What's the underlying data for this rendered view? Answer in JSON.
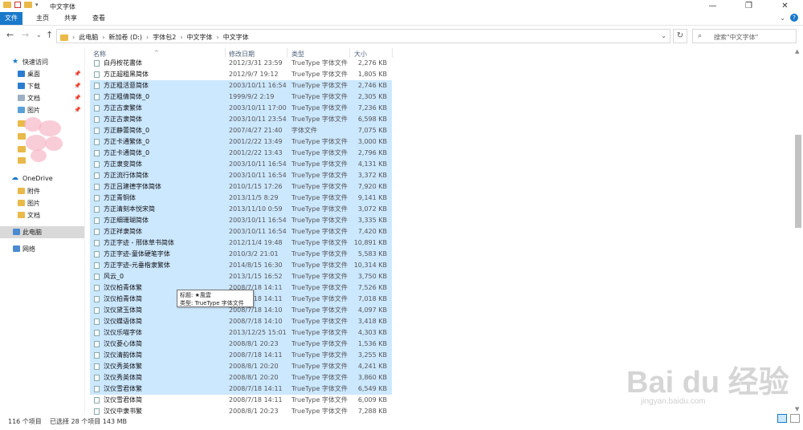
{
  "window": {
    "title": "中文字体",
    "buttons": [
      "—",
      "❐",
      "✕"
    ]
  },
  "ribbon": {
    "tabs": [
      "文件",
      "主页",
      "共享",
      "查看"
    ]
  },
  "address": {
    "crumbs": [
      "此电脑",
      "新加卷 (D:)",
      "字体包2",
      "中文字体",
      "中文字体"
    ],
    "separator": "›"
  },
  "search": {
    "placeholder": "搜索\"中文字体\""
  },
  "nav": {
    "quick_access": "快速访问",
    "items": [
      "桌面",
      "下载",
      "文档",
      "图片"
    ],
    "onedrive": "OneDrive",
    "onedrive_items": [
      "附件",
      "图片",
      "文档"
    ],
    "this_pc": "此电脑",
    "network": "网络"
  },
  "columns": {
    "name": "名称",
    "date": "修改日期",
    "type": "类型",
    "size": "大小"
  },
  "files": [
    {
      "name": "白丹桉花書体",
      "date": "2012/3/31 23:59",
      "type": "TrueType 字体文件",
      "size": "2,276 KB",
      "selected": false
    },
    {
      "name": "方正超粗黑简体",
      "date": "2012/9/7 19:12",
      "type": "TrueType 字体文件",
      "size": "1,805 KB",
      "selected": false
    },
    {
      "name": "方正粗活意简体",
      "date": "2003/10/11 16:54",
      "type": "TrueType 字体文件",
      "size": "2,746 KB",
      "selected": true
    },
    {
      "name": "方正粗倩简体_0",
      "date": "1999/9/2 2:19",
      "type": "TrueType 字体文件",
      "size": "2,305 KB",
      "selected": true
    },
    {
      "name": "方正古隶繁体",
      "date": "2003/10/11 17:00",
      "type": "TrueType 字体文件",
      "size": "7,236 KB",
      "selected": true
    },
    {
      "name": "方正古隶简体",
      "date": "2003/10/11 23:54",
      "type": "TrueType 字体文件",
      "size": "6,598 KB",
      "selected": true
    },
    {
      "name": "方正静蕾简体_0",
      "date": "2007/4/27 21:40",
      "type": "字体文件",
      "size": "7,075 KB",
      "selected": true
    },
    {
      "name": "方正卡通繁体_0",
      "date": "2001/2/22 13:49",
      "type": "TrueType 字体文件",
      "size": "3,000 KB",
      "selected": true
    },
    {
      "name": "方正卡通简体_0",
      "date": "2001/2/22 13:43",
      "type": "TrueType 字体文件",
      "size": "2,796 KB",
      "selected": true
    },
    {
      "name": "方正隶变简体",
      "date": "2003/10/11 16:54",
      "type": "TrueType 字体文件",
      "size": "4,131 KB",
      "selected": true
    },
    {
      "name": "方正流行体简体",
      "date": "2003/10/11 16:54",
      "type": "TrueType 字体文件",
      "size": "3,372 KB",
      "selected": true
    },
    {
      "name": "方正吕建德字体简体",
      "date": "2010/1/15 17:26",
      "type": "TrueType 字体文件",
      "size": "7,920 KB",
      "selected": true
    },
    {
      "name": "方正青铜体",
      "date": "2013/11/5 8:29",
      "type": "TrueType 字体文件",
      "size": "9,141 KB",
      "selected": true
    },
    {
      "name": "方正清刻本悦宋简",
      "date": "2013/11/10 0:59",
      "type": "TrueType 字体文件",
      "size": "3,072 KB",
      "selected": true
    },
    {
      "name": "方正细珊瑚简体",
      "date": "2003/10/11 16:54",
      "type": "TrueType 字体文件",
      "size": "3,335 KB",
      "selected": true
    },
    {
      "name": "方正祥隶简体",
      "date": "2003/10/11 16:54",
      "type": "TrueType 字体文件",
      "size": "7,420 KB",
      "selected": true
    },
    {
      "name": "方正字迹 - 邢体草书简体",
      "date": "2012/11/4 19:48",
      "type": "TrueType 字体文件",
      "size": "10,891 KB",
      "selected": true
    },
    {
      "name": "方正字迹-童体硬笔字体",
      "date": "2010/3/2 21:01",
      "type": "TrueType 字体文件",
      "size": "5,583 KB",
      "selected": true
    },
    {
      "name": "方正字迹-元垂楷隶繁体",
      "date": "2014/8/15 16:30",
      "type": "TrueType 字体文件",
      "size": "10,314 KB",
      "selected": true
    },
    {
      "name": "风云_0",
      "date": "2013/1/15 16:52",
      "type": "TrueType 字体文件",
      "size": "3,750 KB",
      "selected": true
    },
    {
      "name": "汉仪柏青体繁",
      "date": "2008/7/18 14:11",
      "type": "TrueType 字体文件",
      "size": "7,526 KB",
      "selected": true
    },
    {
      "name": "汉仪柏青体简",
      "date": "2008/7/18 14:11",
      "type": "TrueType 字体文件",
      "size": "7,018 KB",
      "selected": true
    },
    {
      "name": "汉仪黛玉体简",
      "date": "2008/7/18 14:10",
      "type": "TrueType 字体文件",
      "size": "4,097 KB",
      "selected": true
    },
    {
      "name": "汉仪蝶语体简",
      "date": "2008/7/18 14:10",
      "type": "TrueType 字体文件",
      "size": "3,418 KB",
      "selected": true
    },
    {
      "name": "汉仪乐喵字体",
      "date": "2013/12/25 15:01",
      "type": "TrueType 字体文件",
      "size": "4,303 KB",
      "selected": true
    },
    {
      "name": "汉仪菱心体简",
      "date": "2008/8/1 20:23",
      "type": "TrueType 字体文件",
      "size": "1,536 KB",
      "selected": true
    },
    {
      "name": "汉仪清韵体简",
      "date": "2008/7/18 14:11",
      "type": "TrueType 字体文件",
      "size": "3,255 KB",
      "selected": true
    },
    {
      "name": "汉仪秀英体繁",
      "date": "2008/8/1 20:20",
      "type": "TrueType 字体文件",
      "size": "4,241 KB",
      "selected": true
    },
    {
      "name": "汉仪秀英体简",
      "date": "2008/8/1 20:20",
      "type": "TrueType 字体文件",
      "size": "3,860 KB",
      "selected": true
    },
    {
      "name": "汉仪雪君体繁",
      "date": "2008/7/18 14:11",
      "type": "TrueType 字体文件",
      "size": "6,549 KB",
      "selected": true
    },
    {
      "name": "汉仪雪君体简",
      "date": "2008/7/18 14:11",
      "type": "TrueType 字体文件",
      "size": "6,009 KB",
      "selected": false
    },
    {
      "name": "汉仪中隶书繁",
      "date": "2008/8/1 20:23",
      "type": "TrueType 字体文件",
      "size": "7,288 KB",
      "selected": false
    }
  ],
  "tooltip": {
    "line1": "标题: ★風雲",
    "line2": "类型: TrueType 字体文件"
  },
  "status": {
    "count": "116 个项目",
    "selected": "已选择 28 个项目  143 MB"
  },
  "watermark": {
    "logo": "Bai du 经验",
    "url": "jingyan.baidu.com"
  },
  "colors": {
    "accent": "#1979ca",
    "selection": "#cce8ff"
  }
}
